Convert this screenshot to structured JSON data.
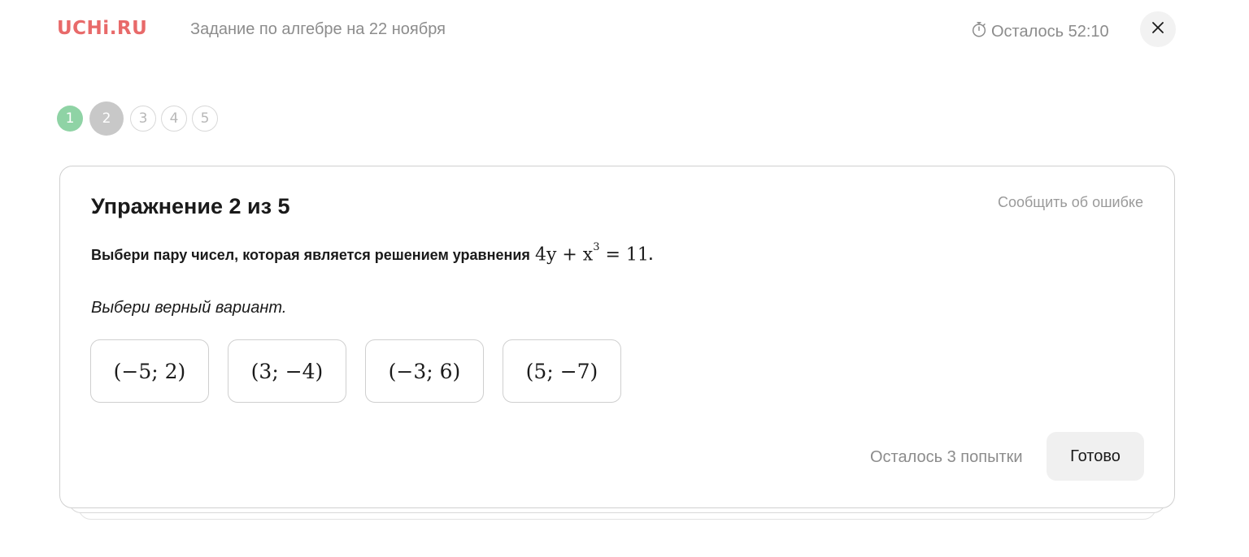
{
  "header": {
    "logo": "UCHi.RU",
    "task_title": "Задание по алгебре на 22 ноября",
    "timer_text": "Осталось 52:10",
    "timer_icon": "stopwatch-icon",
    "close_icon": "close-icon"
  },
  "steps": [
    {
      "label": "1",
      "status": "done",
      "color": "#8fd3a5"
    },
    {
      "label": "2",
      "status": "current",
      "color": "#c8c8c8"
    },
    {
      "label": "3",
      "status": "todo"
    },
    {
      "label": "4",
      "status": "todo"
    },
    {
      "label": "5",
      "status": "todo"
    }
  ],
  "card": {
    "title": "Упражнение 2 из 5",
    "report_link": "Сообщить об ошибке",
    "question_text": "Выбери пару чисел, которая является решением уравнения",
    "equation_left": "4y + x",
    "equation_exp": "3",
    "equation_right": " = 11",
    "question_end": ".",
    "instruction": "Выбери верный вариант.",
    "options": [
      "(−5; 2)",
      "(3; −4)",
      "(−3; 6)",
      "(5; −7)"
    ],
    "attempts_text": "Осталось 3 попытки",
    "ready_label": "Готово"
  },
  "colors": {
    "brand": "#e86a6a",
    "step_done": "#8fd3a5",
    "step_current": "#c8c8c8"
  }
}
